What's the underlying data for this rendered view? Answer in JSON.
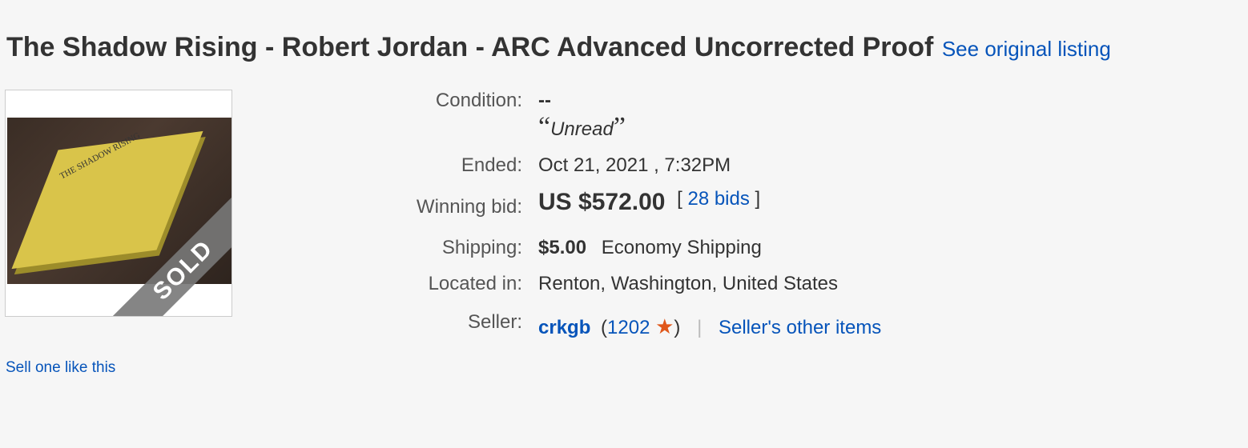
{
  "listing": {
    "title": "The Shadow Rising - Robert Jordan - ARC Advanced Uncorrected Proof",
    "see_original": "See original listing"
  },
  "image": {
    "book_title_text": "THE SHADOW RISING",
    "sold_badge": "SOLD"
  },
  "details": {
    "condition_label": "Condition:",
    "condition_value": "--",
    "condition_note": "Unread",
    "ended_label": "Ended:",
    "ended_value": "Oct 21, 2021 , 7:32PM",
    "winning_bid_label": "Winning bid:",
    "winning_bid_value": "US $572.00",
    "bids_open": "[",
    "bids_link": "28 bids",
    "bids_close": "]",
    "shipping_label": "Shipping:",
    "shipping_cost": "$5.00",
    "shipping_method": "Economy Shipping",
    "located_label": "Located in:",
    "located_value": "Renton, Washington, United States",
    "seller_label": "Seller:",
    "seller_name": "crkgb",
    "seller_feedback": "1202",
    "seller_other": "Seller's other items"
  },
  "footer": {
    "sell_link": "Sell one like this"
  },
  "colors": {
    "link": "#0654ba",
    "star": "#e0571a",
    "background": "#f6f6f6"
  },
  "icons": {
    "feedback_star": "star-icon"
  }
}
